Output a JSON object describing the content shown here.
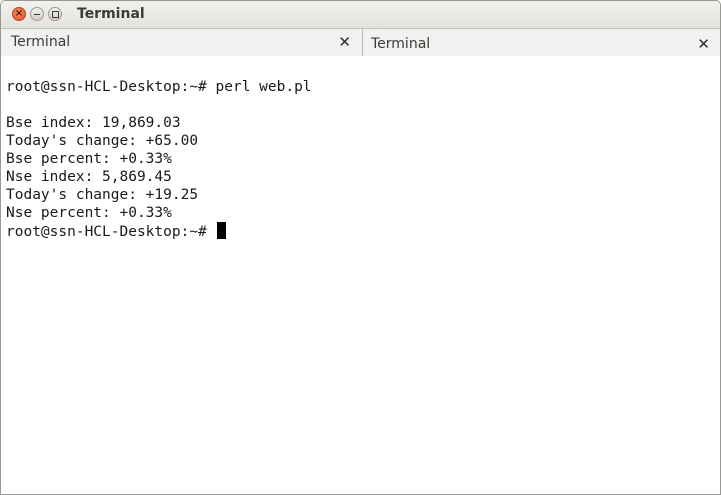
{
  "window": {
    "title": "Terminal"
  },
  "tabs": [
    {
      "label": "Terminal",
      "active": true
    },
    {
      "label": "Terminal",
      "active": false
    }
  ],
  "terminal": {
    "command_line": "root@ssn-HCL-Desktop:~# perl web.pl",
    "output": [
      "Bse index: 19,869.03",
      "Today's change: +65.00",
      "Bse percent: +0.33%",
      "Nse index: 5,869.45",
      "Today's change: +19.25",
      "Nse percent: +0.33%"
    ],
    "prompt": "root@ssn-HCL-Desktop:~# "
  },
  "icons": {
    "close": "close-icon",
    "minimize": "minimize-icon",
    "maximize": "maximize-icon",
    "tab_close": "close-icon"
  },
  "colors": {
    "close_button": "#e0531f",
    "terminal_background": "#ffffff",
    "terminal_text": "#1a1a1a"
  }
}
